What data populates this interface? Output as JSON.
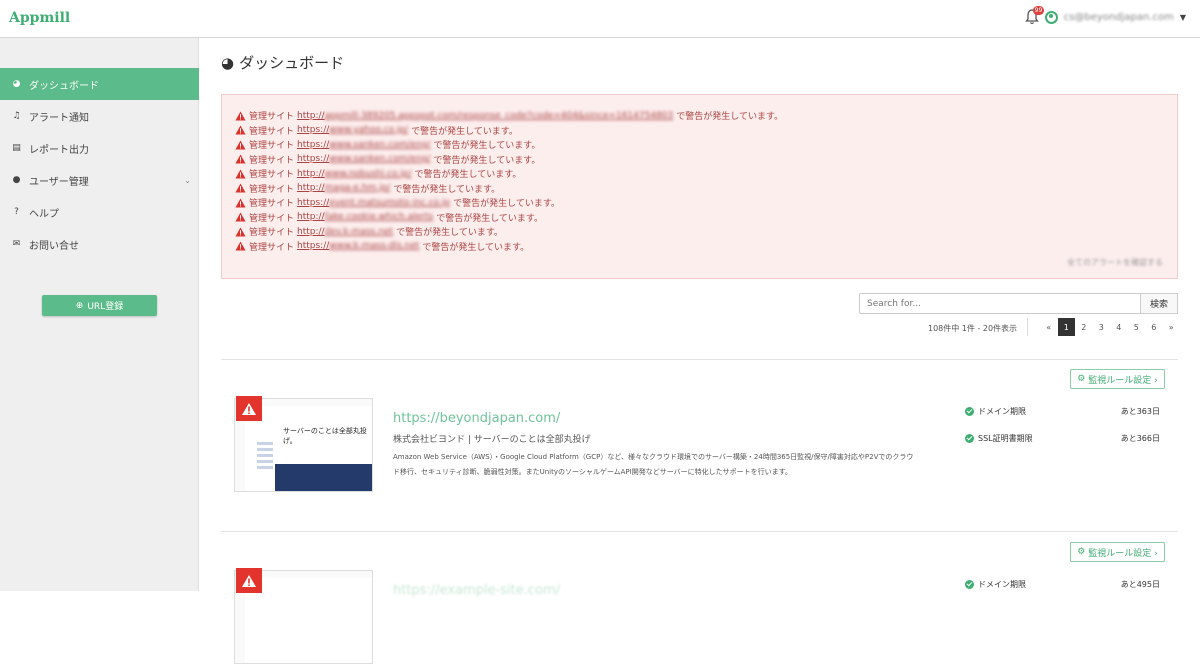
{
  "app": {
    "logo": "Appmill",
    "notification_count": "99",
    "user_email": "cs@beyondjapan.com"
  },
  "sidebar": {
    "items": [
      {
        "label": "ダッシュボード",
        "icon": "dashboard-icon",
        "active": true
      },
      {
        "label": "アラート通知",
        "icon": "bell-icon"
      },
      {
        "label": "レポート出力",
        "icon": "document-icon"
      },
      {
        "label": "ユーザー管理",
        "icon": "user-icon",
        "has_submenu": true
      },
      {
        "label": "ヘルプ",
        "icon": "question-icon"
      },
      {
        "label": "お問い合せ",
        "icon": "mail-icon"
      }
    ],
    "url_button": "URL登録"
  },
  "page": {
    "title": "ダッシュボード"
  },
  "alerts": {
    "prefix": "管理サイト",
    "suffix": "で警告が発生しています。",
    "lines": [
      {
        "scheme": "http://",
        "domain": "appmill-389205.appspot.com/response_code?code=404&since=1614754803"
      },
      {
        "scheme": "https://",
        "domain": "www.yahoo.co.jp/"
      },
      {
        "scheme": "https://",
        "domain": "www.sanken.com/eng/"
      },
      {
        "scheme": "https://",
        "domain": "www.sanken.com/eng/"
      },
      {
        "scheme": "http://",
        "domain": "www.nobushi.co.jp/"
      },
      {
        "scheme": "http://",
        "domain": "maga-e.hm.jp/"
      },
      {
        "scheme": "https://",
        "domain": "event.matsumoto-inc.co.jp"
      },
      {
        "scheme": "http://",
        "domain": "fake.cookie.which.alerts"
      },
      {
        "scheme": "http://",
        "domain": "dev.k-mass.net"
      },
      {
        "scheme": "https://",
        "domain": "www.k-mass-dis.net"
      }
    ],
    "more_link": "全てのアラートを確認する"
  },
  "search": {
    "placeholder": "Search for...",
    "button": "検索"
  },
  "pagination": {
    "summary": "108件中 1件 - 20件表示",
    "prev": "«",
    "pages": [
      "1",
      "2",
      "3",
      "4",
      "5",
      "6"
    ],
    "current": "1",
    "next": "»"
  },
  "sites": [
    {
      "rule_button": "監視ルール設定 ›",
      "url": "https://beyondjapan.com/",
      "name": "株式会社ビヨンド | サーバーのことは全部丸投げ",
      "description": "Amazon Web Service（AWS）・Google Cloud Platform（GCP）など、様々なクラウド環境でのサーバー構築・24時間365日監視/保守/障害対応やP2Vでのクラウド移行、セキュリティ診断、脆弱性対策。またUnityのソーシャルゲームAPI開発などサーバーに特化したサポートを行います。",
      "thumb_text": "サーバーのことは全部丸投げ。",
      "domain_label": "ドメイン期限",
      "domain_value": "あと363日",
      "ssl_label": "SSL証明書期限",
      "ssl_value": "あと366日"
    },
    {
      "rule_button": "監視ルール設定 ›",
      "url": "https://example-site.com/",
      "domain_label": "ドメイン期限",
      "domain_value": "あと495日"
    }
  ],
  "colors": {
    "accent": "#5cbb8a",
    "alert_bg": "#fdeeee",
    "alert_text": "#a94442",
    "warn_red": "#e2342d"
  }
}
